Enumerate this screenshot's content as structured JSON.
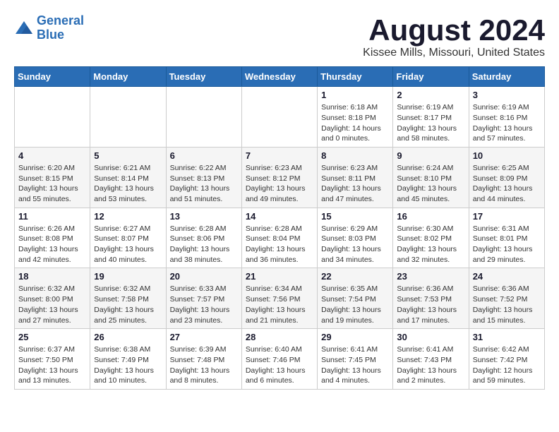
{
  "header": {
    "logo_line1": "General",
    "logo_line2": "Blue",
    "main_title": "August 2024",
    "subtitle": "Kissee Mills, Missouri, United States"
  },
  "weekdays": [
    "Sunday",
    "Monday",
    "Tuesday",
    "Wednesday",
    "Thursday",
    "Friday",
    "Saturday"
  ],
  "weeks": [
    [
      {
        "day": "",
        "info": ""
      },
      {
        "day": "",
        "info": ""
      },
      {
        "day": "",
        "info": ""
      },
      {
        "day": "",
        "info": ""
      },
      {
        "day": "1",
        "info": "Sunrise: 6:18 AM\nSunset: 8:18 PM\nDaylight: 14 hours\nand 0 minutes."
      },
      {
        "day": "2",
        "info": "Sunrise: 6:19 AM\nSunset: 8:17 PM\nDaylight: 13 hours\nand 58 minutes."
      },
      {
        "day": "3",
        "info": "Sunrise: 6:19 AM\nSunset: 8:16 PM\nDaylight: 13 hours\nand 57 minutes."
      }
    ],
    [
      {
        "day": "4",
        "info": "Sunrise: 6:20 AM\nSunset: 8:15 PM\nDaylight: 13 hours\nand 55 minutes."
      },
      {
        "day": "5",
        "info": "Sunrise: 6:21 AM\nSunset: 8:14 PM\nDaylight: 13 hours\nand 53 minutes."
      },
      {
        "day": "6",
        "info": "Sunrise: 6:22 AM\nSunset: 8:13 PM\nDaylight: 13 hours\nand 51 minutes."
      },
      {
        "day": "7",
        "info": "Sunrise: 6:23 AM\nSunset: 8:12 PM\nDaylight: 13 hours\nand 49 minutes."
      },
      {
        "day": "8",
        "info": "Sunrise: 6:23 AM\nSunset: 8:11 PM\nDaylight: 13 hours\nand 47 minutes."
      },
      {
        "day": "9",
        "info": "Sunrise: 6:24 AM\nSunset: 8:10 PM\nDaylight: 13 hours\nand 45 minutes."
      },
      {
        "day": "10",
        "info": "Sunrise: 6:25 AM\nSunset: 8:09 PM\nDaylight: 13 hours\nand 44 minutes."
      }
    ],
    [
      {
        "day": "11",
        "info": "Sunrise: 6:26 AM\nSunset: 8:08 PM\nDaylight: 13 hours\nand 42 minutes."
      },
      {
        "day": "12",
        "info": "Sunrise: 6:27 AM\nSunset: 8:07 PM\nDaylight: 13 hours\nand 40 minutes."
      },
      {
        "day": "13",
        "info": "Sunrise: 6:28 AM\nSunset: 8:06 PM\nDaylight: 13 hours\nand 38 minutes."
      },
      {
        "day": "14",
        "info": "Sunrise: 6:28 AM\nSunset: 8:04 PM\nDaylight: 13 hours\nand 36 minutes."
      },
      {
        "day": "15",
        "info": "Sunrise: 6:29 AM\nSunset: 8:03 PM\nDaylight: 13 hours\nand 34 minutes."
      },
      {
        "day": "16",
        "info": "Sunrise: 6:30 AM\nSunset: 8:02 PM\nDaylight: 13 hours\nand 32 minutes."
      },
      {
        "day": "17",
        "info": "Sunrise: 6:31 AM\nSunset: 8:01 PM\nDaylight: 13 hours\nand 29 minutes."
      }
    ],
    [
      {
        "day": "18",
        "info": "Sunrise: 6:32 AM\nSunset: 8:00 PM\nDaylight: 13 hours\nand 27 minutes."
      },
      {
        "day": "19",
        "info": "Sunrise: 6:32 AM\nSunset: 7:58 PM\nDaylight: 13 hours\nand 25 minutes."
      },
      {
        "day": "20",
        "info": "Sunrise: 6:33 AM\nSunset: 7:57 PM\nDaylight: 13 hours\nand 23 minutes."
      },
      {
        "day": "21",
        "info": "Sunrise: 6:34 AM\nSunset: 7:56 PM\nDaylight: 13 hours\nand 21 minutes."
      },
      {
        "day": "22",
        "info": "Sunrise: 6:35 AM\nSunset: 7:54 PM\nDaylight: 13 hours\nand 19 minutes."
      },
      {
        "day": "23",
        "info": "Sunrise: 6:36 AM\nSunset: 7:53 PM\nDaylight: 13 hours\nand 17 minutes."
      },
      {
        "day": "24",
        "info": "Sunrise: 6:36 AM\nSunset: 7:52 PM\nDaylight: 13 hours\nand 15 minutes."
      }
    ],
    [
      {
        "day": "25",
        "info": "Sunrise: 6:37 AM\nSunset: 7:50 PM\nDaylight: 13 hours\nand 13 minutes."
      },
      {
        "day": "26",
        "info": "Sunrise: 6:38 AM\nSunset: 7:49 PM\nDaylight: 13 hours\nand 10 minutes."
      },
      {
        "day": "27",
        "info": "Sunrise: 6:39 AM\nSunset: 7:48 PM\nDaylight: 13 hours\nand 8 minutes."
      },
      {
        "day": "28",
        "info": "Sunrise: 6:40 AM\nSunset: 7:46 PM\nDaylight: 13 hours\nand 6 minutes."
      },
      {
        "day": "29",
        "info": "Sunrise: 6:41 AM\nSunset: 7:45 PM\nDaylight: 13 hours\nand 4 minutes."
      },
      {
        "day": "30",
        "info": "Sunrise: 6:41 AM\nSunset: 7:43 PM\nDaylight: 13 hours\nand 2 minutes."
      },
      {
        "day": "31",
        "info": "Sunrise: 6:42 AM\nSunset: 7:42 PM\nDaylight: 12 hours\nand 59 minutes."
      }
    ]
  ]
}
